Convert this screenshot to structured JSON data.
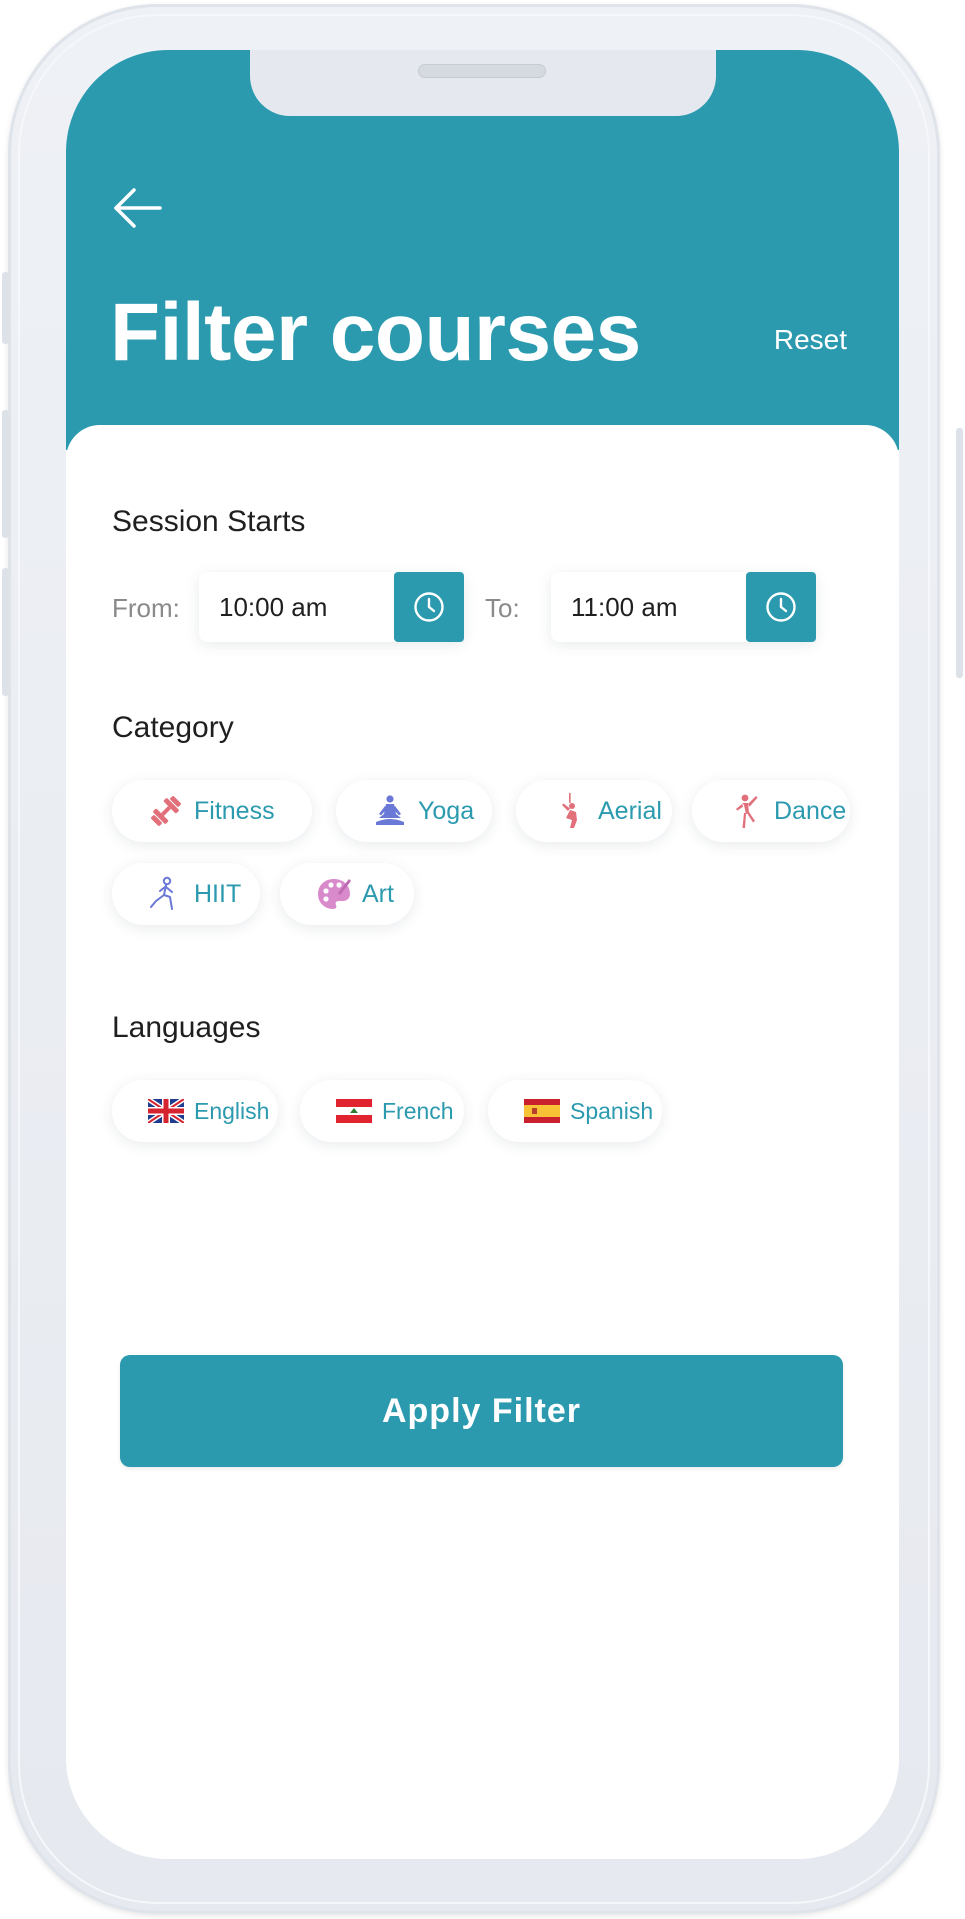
{
  "header": {
    "title": "Filter courses",
    "reset_label": "Reset",
    "back_icon": "arrow-left-icon",
    "color": "#2b9aaf"
  },
  "session": {
    "label": "Session Starts",
    "from_label": "From:",
    "from_value": "10:00 am",
    "to_label": "To:",
    "to_value": "11:00 am",
    "icon": "clock-icon"
  },
  "category": {
    "label": "Category",
    "items": [
      {
        "label": "Fitness",
        "icon": "dumbbell-icon",
        "color": "#e2707a"
      },
      {
        "label": "Yoga",
        "icon": "yoga-icon",
        "color": "#6a78d6"
      },
      {
        "label": "Aerial",
        "icon": "aerial-dancer-icon",
        "color": "#e2707a"
      },
      {
        "label": "Dance",
        "icon": "dancer-icon",
        "color": "#e2707a"
      },
      {
        "label": "HIIT",
        "icon": "lunge-icon",
        "color": "#6a78d6"
      },
      {
        "label": "Art",
        "icon": "palette-icon",
        "color": "#d98acb"
      }
    ]
  },
  "languages": {
    "label": "Languages",
    "items": [
      {
        "label": "English",
        "icon": "uk-flag-icon"
      },
      {
        "label": "French",
        "icon": "flag-icon"
      },
      {
        "label": "Spanish",
        "icon": "spain-flag-icon"
      }
    ]
  },
  "apply_label": "Apply Filter"
}
